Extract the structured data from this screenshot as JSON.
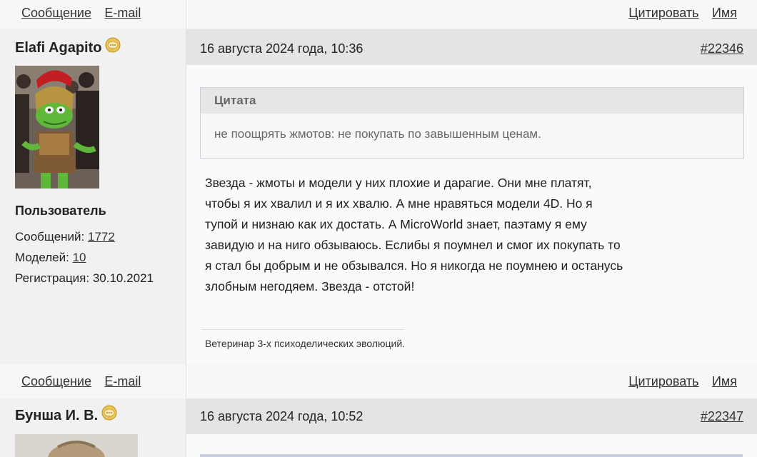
{
  "actions": {
    "message": "Сообщение",
    "email": "E-mail",
    "quote": "Цитировать",
    "name": "Имя"
  },
  "posts": [
    {
      "username": "Elafi Agapito",
      "avatar_icon": "avatar-kermit-legionary",
      "role": "Пользователь",
      "messages_label": "Сообщений:",
      "messages_count": "1772",
      "models_label": "Моделей:",
      "models_count": "10",
      "registration_label": "Регистрация:",
      "registration_date": "30.10.2021",
      "date": "16 августа 2024 года, 10:36",
      "number": "#22346",
      "quote_title": "Цитата",
      "quote_text": "не поощрять жмотов: не покупать по завышенным ценам.",
      "body_lines": [
        "Звезда - жмоты и модели у них плохие и дарагие. Они мне платят,",
        "чтобы я их хвалил и я их хвалю. А мне нравяться модели 4D. Но я",
        "тупой и низнаю как их достать. А MicroWorld знает, паэтаму я ему",
        "завидую и на ниго обзываюсь. Еслибы я поумнел и смог их покупать то",
        "я стал бы добрым и не обзывался. Но я никогда не поумнею и останусь",
        "злобным негодяем. Звезда - отстой!"
      ],
      "signature": "Ветеринар 3-х психоделических эволюций."
    },
    {
      "username": "Бунша И. В.",
      "date": "16 августа 2024 года, 10:52",
      "number": "#22347"
    }
  ],
  "colors": {
    "page_bg": "#f1f1f1",
    "header_bg": "#e4e4e4",
    "quote_border": "#c7d0dc"
  }
}
